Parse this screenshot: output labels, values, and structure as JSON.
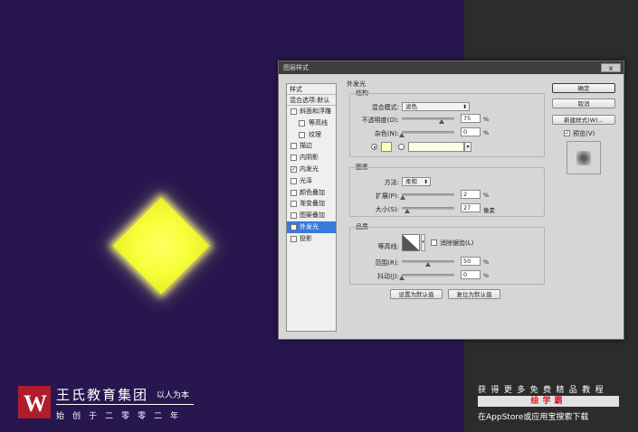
{
  "dialog": {
    "title": "图层样式",
    "close_label": "x"
  },
  "styles_panel": {
    "header": "样式",
    "blend_default": "混合选项:默认",
    "items": [
      {
        "label": "斜面和浮雕",
        "checked": false,
        "sub": false,
        "selected": false
      },
      {
        "label": "等高线",
        "checked": false,
        "sub": true,
        "selected": false
      },
      {
        "label": "纹理",
        "checked": false,
        "sub": true,
        "selected": false
      },
      {
        "label": "描边",
        "checked": false,
        "sub": false,
        "selected": false
      },
      {
        "label": "内阴影",
        "checked": false,
        "sub": false,
        "selected": false
      },
      {
        "label": "内发光",
        "checked": true,
        "sub": false,
        "selected": false
      },
      {
        "label": "光泽",
        "checked": false,
        "sub": false,
        "selected": false
      },
      {
        "label": "颜色叠加",
        "checked": false,
        "sub": false,
        "selected": false
      },
      {
        "label": "渐变叠加",
        "checked": false,
        "sub": false,
        "selected": false
      },
      {
        "label": "图案叠加",
        "checked": false,
        "sub": false,
        "selected": false
      },
      {
        "label": "外发光",
        "checked": true,
        "sub": false,
        "selected": true
      },
      {
        "label": "投影",
        "checked": false,
        "sub": false,
        "selected": false
      }
    ]
  },
  "outer_glow": {
    "title": "外发光",
    "structure": {
      "title": "结构",
      "blend_mode_label": "混合模式:",
      "blend_mode_value": "滤色",
      "opacity_label": "不透明度(O):",
      "opacity_value": "75",
      "opacity_unit": "%",
      "opacity_fraction": 0.75,
      "noise_label": "杂色(N):",
      "noise_value": "0",
      "noise_unit": "%",
      "noise_fraction": 0.0,
      "glow_color": "#ffffc0"
    },
    "elements": {
      "title": "图素",
      "method_label": "方法:",
      "method_value": "柔和",
      "spread_label": "扩展(P):",
      "spread_value": "2",
      "spread_unit": "%",
      "spread_fraction": 0.02,
      "size_label": "大小(S):",
      "size_value": "27",
      "size_unit": "像素",
      "size_fraction": 0.11
    },
    "quality": {
      "title": "品质",
      "contour_label": "等高线:",
      "antialias_label": "消除锯齿(L)",
      "range_label": "范围(R):",
      "range_value": "50",
      "range_unit": "%",
      "range_fraction": 0.5,
      "jitter_label": "抖动(J):",
      "jitter_value": "0",
      "jitter_unit": "%",
      "jitter_fraction": 0.0
    },
    "make_default_label": "设置为默认值",
    "reset_default_label": "复位为默认值"
  },
  "buttons": {
    "ok": "确定",
    "cancel": "取消",
    "new_style": "新建样式(W)...",
    "preview_label": "预览(V)"
  },
  "watermark_left": {
    "logo_letter": "W",
    "title": "王氏教育集团",
    "slogan": "以人为本",
    "since": "始创于二零零二年",
    "brand_color": "#b01c2b"
  },
  "watermark_right": {
    "line1": "获得更多免费精品教程",
    "app_name": "绘学霸",
    "line2": "在AppStore或应用宝搜索下载",
    "accent_color": "#d31f26"
  },
  "canvas": {
    "background": "#28164f",
    "shape_color": "#f7ff3a"
  }
}
